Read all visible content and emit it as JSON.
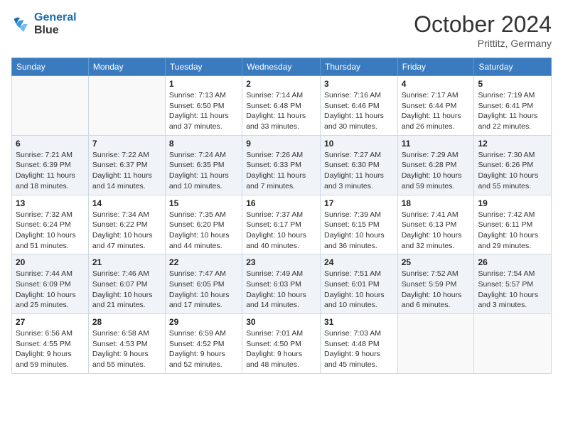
{
  "logo": {
    "line1": "General",
    "line2": "Blue"
  },
  "title": "October 2024",
  "location": "Prittitz, Germany",
  "days_header": [
    "Sunday",
    "Monday",
    "Tuesday",
    "Wednesday",
    "Thursday",
    "Friday",
    "Saturday"
  ],
  "weeks": [
    [
      {
        "day": "",
        "info": ""
      },
      {
        "day": "",
        "info": ""
      },
      {
        "day": "1",
        "info": "Sunrise: 7:13 AM\nSunset: 6:50 PM\nDaylight: 11 hours\nand 37 minutes."
      },
      {
        "day": "2",
        "info": "Sunrise: 7:14 AM\nSunset: 6:48 PM\nDaylight: 11 hours\nand 33 minutes."
      },
      {
        "day": "3",
        "info": "Sunrise: 7:16 AM\nSunset: 6:46 PM\nDaylight: 11 hours\nand 30 minutes."
      },
      {
        "day": "4",
        "info": "Sunrise: 7:17 AM\nSunset: 6:44 PM\nDaylight: 11 hours\nand 26 minutes."
      },
      {
        "day": "5",
        "info": "Sunrise: 7:19 AM\nSunset: 6:41 PM\nDaylight: 11 hours\nand 22 minutes."
      }
    ],
    [
      {
        "day": "6",
        "info": "Sunrise: 7:21 AM\nSunset: 6:39 PM\nDaylight: 11 hours\nand 18 minutes."
      },
      {
        "day": "7",
        "info": "Sunrise: 7:22 AM\nSunset: 6:37 PM\nDaylight: 11 hours\nand 14 minutes."
      },
      {
        "day": "8",
        "info": "Sunrise: 7:24 AM\nSunset: 6:35 PM\nDaylight: 11 hours\nand 10 minutes."
      },
      {
        "day": "9",
        "info": "Sunrise: 7:26 AM\nSunset: 6:33 PM\nDaylight: 11 hours\nand 7 minutes."
      },
      {
        "day": "10",
        "info": "Sunrise: 7:27 AM\nSunset: 6:30 PM\nDaylight: 11 hours\nand 3 minutes."
      },
      {
        "day": "11",
        "info": "Sunrise: 7:29 AM\nSunset: 6:28 PM\nDaylight: 10 hours\nand 59 minutes."
      },
      {
        "day": "12",
        "info": "Sunrise: 7:30 AM\nSunset: 6:26 PM\nDaylight: 10 hours\nand 55 minutes."
      }
    ],
    [
      {
        "day": "13",
        "info": "Sunrise: 7:32 AM\nSunset: 6:24 PM\nDaylight: 10 hours\nand 51 minutes."
      },
      {
        "day": "14",
        "info": "Sunrise: 7:34 AM\nSunset: 6:22 PM\nDaylight: 10 hours\nand 47 minutes."
      },
      {
        "day": "15",
        "info": "Sunrise: 7:35 AM\nSunset: 6:20 PM\nDaylight: 10 hours\nand 44 minutes."
      },
      {
        "day": "16",
        "info": "Sunrise: 7:37 AM\nSunset: 6:17 PM\nDaylight: 10 hours\nand 40 minutes."
      },
      {
        "day": "17",
        "info": "Sunrise: 7:39 AM\nSunset: 6:15 PM\nDaylight: 10 hours\nand 36 minutes."
      },
      {
        "day": "18",
        "info": "Sunrise: 7:41 AM\nSunset: 6:13 PM\nDaylight: 10 hours\nand 32 minutes."
      },
      {
        "day": "19",
        "info": "Sunrise: 7:42 AM\nSunset: 6:11 PM\nDaylight: 10 hours\nand 29 minutes."
      }
    ],
    [
      {
        "day": "20",
        "info": "Sunrise: 7:44 AM\nSunset: 6:09 PM\nDaylight: 10 hours\nand 25 minutes."
      },
      {
        "day": "21",
        "info": "Sunrise: 7:46 AM\nSunset: 6:07 PM\nDaylight: 10 hours\nand 21 minutes."
      },
      {
        "day": "22",
        "info": "Sunrise: 7:47 AM\nSunset: 6:05 PM\nDaylight: 10 hours\nand 17 minutes."
      },
      {
        "day": "23",
        "info": "Sunrise: 7:49 AM\nSunset: 6:03 PM\nDaylight: 10 hours\nand 14 minutes."
      },
      {
        "day": "24",
        "info": "Sunrise: 7:51 AM\nSunset: 6:01 PM\nDaylight: 10 hours\nand 10 minutes."
      },
      {
        "day": "25",
        "info": "Sunrise: 7:52 AM\nSunset: 5:59 PM\nDaylight: 10 hours\nand 6 minutes."
      },
      {
        "day": "26",
        "info": "Sunrise: 7:54 AM\nSunset: 5:57 PM\nDaylight: 10 hours\nand 3 minutes."
      }
    ],
    [
      {
        "day": "27",
        "info": "Sunrise: 6:56 AM\nSunset: 4:55 PM\nDaylight: 9 hours\nand 59 minutes."
      },
      {
        "day": "28",
        "info": "Sunrise: 6:58 AM\nSunset: 4:53 PM\nDaylight: 9 hours\nand 55 minutes."
      },
      {
        "day": "29",
        "info": "Sunrise: 6:59 AM\nSunset: 4:52 PM\nDaylight: 9 hours\nand 52 minutes."
      },
      {
        "day": "30",
        "info": "Sunrise: 7:01 AM\nSunset: 4:50 PM\nDaylight: 9 hours\nand 48 minutes."
      },
      {
        "day": "31",
        "info": "Sunrise: 7:03 AM\nSunset: 4:48 PM\nDaylight: 9 hours\nand 45 minutes."
      },
      {
        "day": "",
        "info": ""
      },
      {
        "day": "",
        "info": ""
      }
    ]
  ]
}
